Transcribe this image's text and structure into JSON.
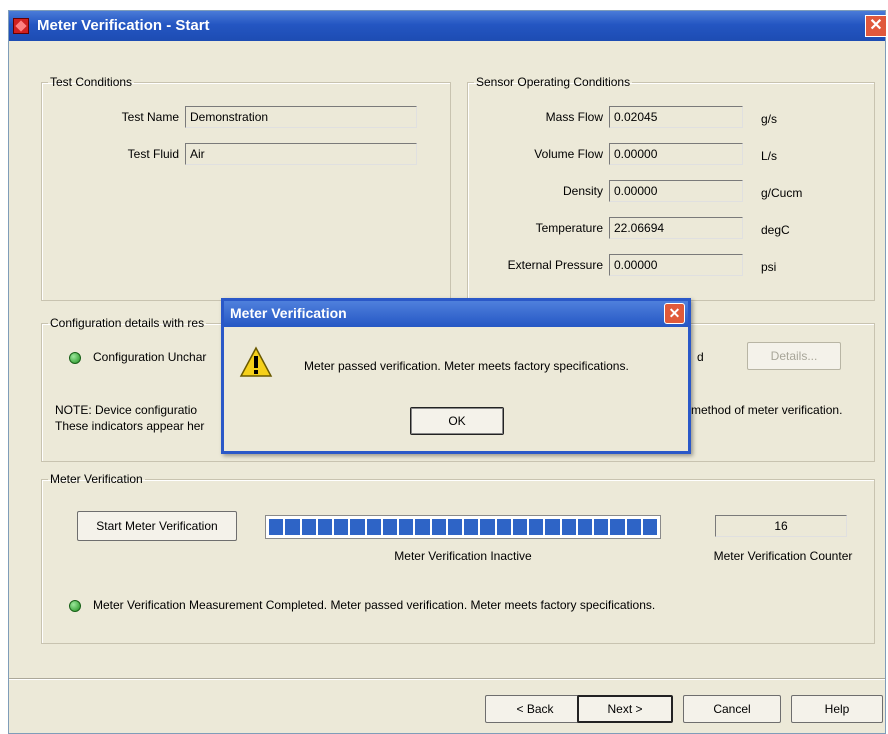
{
  "window": {
    "title": "Meter Verification - Start",
    "close_glyph": "✕"
  },
  "test_conditions": {
    "legend": "Test Conditions",
    "test_name_label": "Test Name",
    "test_name_value": "Demonstration",
    "test_fluid_label": "Test Fluid",
    "test_fluid_value": "Air"
  },
  "sensor": {
    "legend": "Sensor Operating Conditions",
    "rows": [
      {
        "label": "Mass Flow",
        "value": "0.02045",
        "unit": "g/s"
      },
      {
        "label": "Volume Flow",
        "value": "0.00000",
        "unit": "L/s"
      },
      {
        "label": "Density",
        "value": "0.00000",
        "unit": "g/Cucm"
      },
      {
        "label": "Temperature",
        "value": "22.06694",
        "unit": "degC"
      },
      {
        "label": "External Pressure",
        "value": "0.00000",
        "unit": "psi"
      }
    ]
  },
  "config": {
    "legend": "Configuration details with res",
    "status_text": "Configuration Unchar",
    "right_fragment": "d",
    "details_button": "Details...",
    "note_line1": "NOTE:  Device configuratio",
    "note_line1_tail": "method of meter verification.",
    "note_line2": "These indicators appear her"
  },
  "meter_verification": {
    "legend": "Meter Verification",
    "start_button": "Start Meter Verification",
    "progress_fraction": 1.0,
    "progress_status": "Meter Verification Inactive",
    "counter_value": "16",
    "counter_label": "Meter Verification Counter",
    "result_text": "Meter Verification Measurement Completed. Meter passed verification. Meter meets factory specifications."
  },
  "footer": {
    "back": "< Back",
    "next": "Next >",
    "cancel": "Cancel",
    "help": "Help"
  },
  "dialog": {
    "title": "Meter Verification",
    "close_glyph": "✕",
    "message": "Meter passed verification. Meter meets factory specifications.",
    "ok": "OK",
    "icon": "warning-icon"
  },
  "colors": {
    "titlebar": "#2456c2",
    "face": "#ece9d8",
    "progress": "#2e64c6",
    "led_ok": "#2aa52a"
  }
}
